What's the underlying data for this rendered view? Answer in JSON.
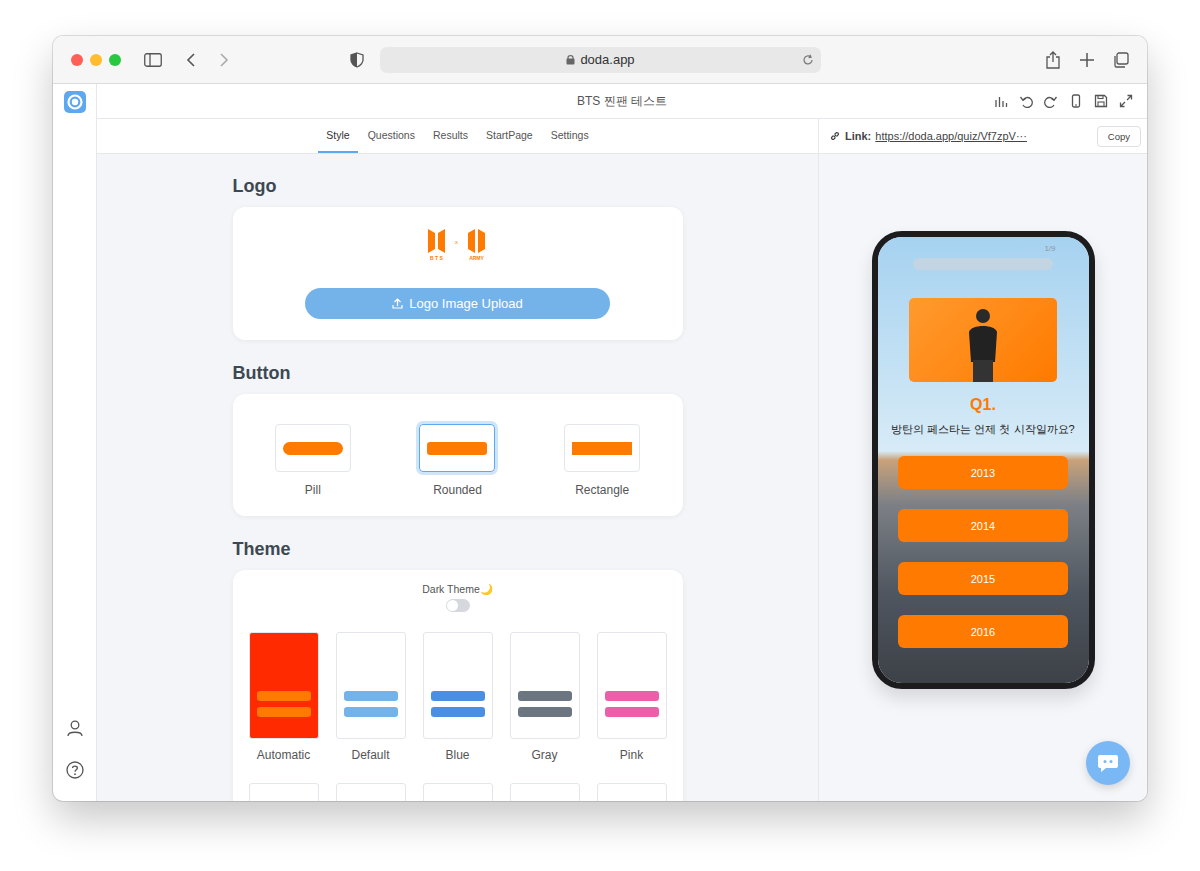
{
  "browser": {
    "url": "doda.app"
  },
  "app": {
    "title": "BTS 찐팬 테스트"
  },
  "tabs": [
    {
      "label": "Style",
      "selected": true
    },
    {
      "label": "Questions",
      "selected": false
    },
    {
      "label": "Results",
      "selected": false
    },
    {
      "label": "StartPage",
      "selected": false
    },
    {
      "label": "Settings",
      "selected": false
    }
  ],
  "link": {
    "label": "Link:",
    "url": "https://doda.app/quiz/Vf7zpV···",
    "button": "Copy"
  },
  "logo_section": {
    "heading": "Logo",
    "upload": "Logo Image Upload",
    "mark": {
      "left": "B T S",
      "mid": "x",
      "right": "ARMY"
    }
  },
  "button_section": {
    "heading": "Button",
    "options": [
      {
        "label": "Pill",
        "kind": "pill",
        "selected": false
      },
      {
        "label": "Rounded",
        "kind": "rounded",
        "selected": true
      },
      {
        "label": "Rectangle",
        "kind": "rectangle",
        "selected": false
      }
    ]
  },
  "theme_section": {
    "heading": "Theme",
    "dark_label": "Dark Theme🌙",
    "dark_on": false,
    "options": [
      {
        "label": "Automatic",
        "color": "#ff7a00",
        "background": "#ff2a00"
      },
      {
        "label": "Default",
        "color": "#74b3ea",
        "background": "#ffffff"
      },
      {
        "label": "Blue",
        "color": "#4a8fe3",
        "background": "#ffffff"
      },
      {
        "label": "Gray",
        "color": "#6b7680",
        "background": "#ffffff"
      },
      {
        "label": "Pink",
        "color": "#ec5fa8",
        "background": "#ffffff"
      },
      {
        "label": "",
        "color": "#ffffff",
        "background": "#ffffff"
      },
      {
        "label": "",
        "color": "#ffffff",
        "background": "#ffffff"
      },
      {
        "label": "",
        "color": "#ffffff",
        "background": "#ffffff"
      },
      {
        "label": "",
        "color": "#ffffff",
        "background": "#ffffff"
      },
      {
        "label": "",
        "color": "#ffffff",
        "background": "#ffffff"
      }
    ]
  },
  "preview": {
    "progress": "1/9",
    "number": "Q1.",
    "question": "방탄의 페스타는 언제 첫 시작일까요?",
    "answers": [
      "2013",
      "2014",
      "2015",
      "2016"
    ]
  }
}
